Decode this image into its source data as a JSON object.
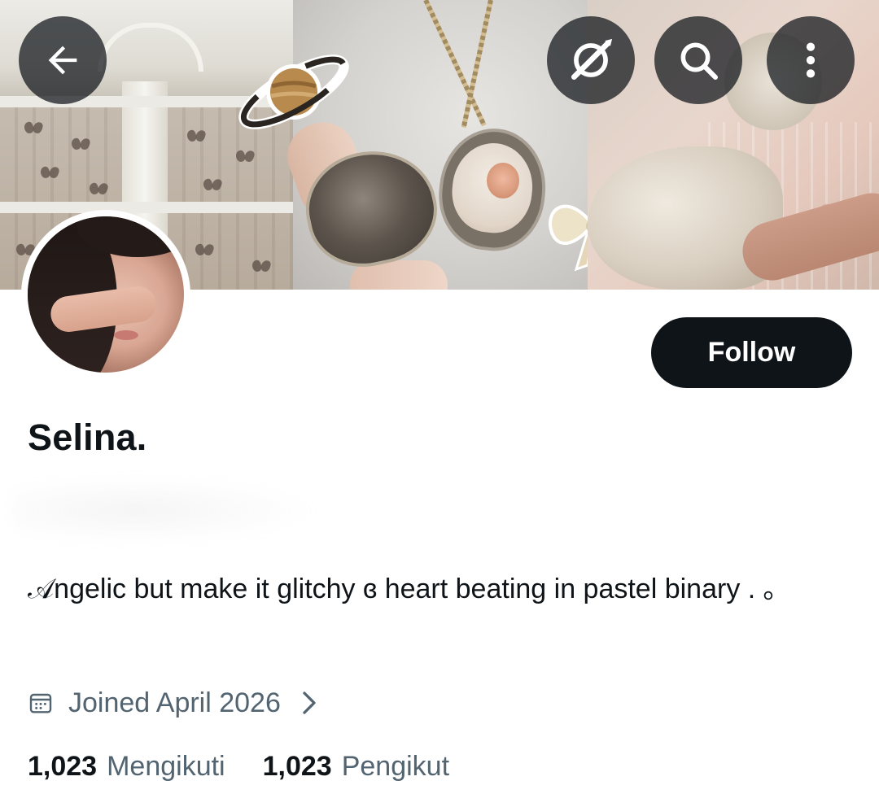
{
  "nav": {
    "back_icon": "arrow-left-icon",
    "grok_icon": "grok-icon",
    "search_icon": "search-icon",
    "more_icon": "more-vertical-icon"
  },
  "profile": {
    "display_name": "Selina.",
    "follow_label": "Follow",
    "bio": "  𝒜ngelic but make it glitchy ɞ heart beating in pastel binary . ｡",
    "joined_text": "Joined April 2026",
    "following_count": "1,023",
    "following_label": "Mengikuti",
    "followers_count": "1,023",
    "followers_label": "Pengikut"
  },
  "colors": {
    "text_primary": "#0f1419",
    "text_secondary": "#536471",
    "button_dark": "#0f1419",
    "background": "#ffffff"
  }
}
